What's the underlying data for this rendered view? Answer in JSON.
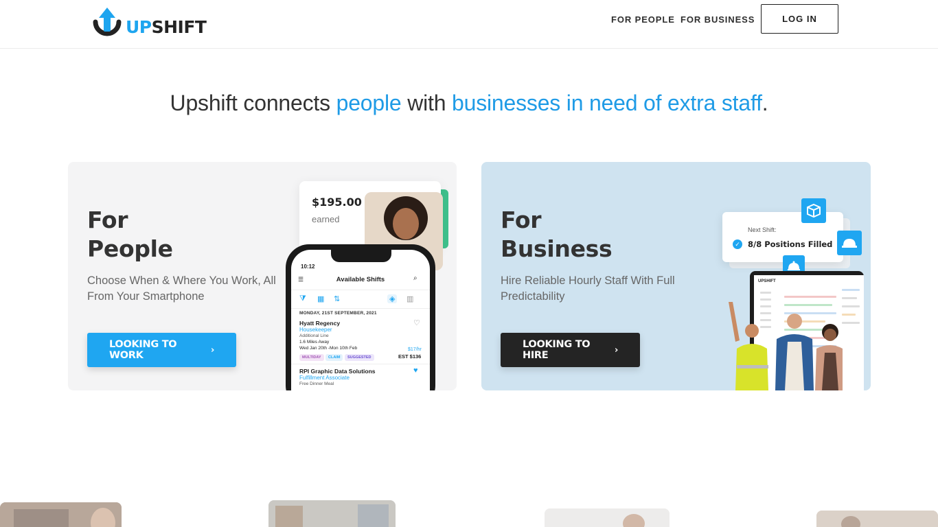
{
  "header": {
    "logo_up": "UP",
    "logo_shift": "SHIFT",
    "nav": {
      "for_people": "FOR PEOPLE",
      "for_business": "FOR BUSINESS",
      "login": "LOG IN"
    }
  },
  "hero": {
    "part1": "Upshift connects ",
    "highlight1": "people",
    "part2": " with ",
    "highlight2": "businesses in need of extra staff",
    "part3": "."
  },
  "people_card": {
    "title_line1": "For",
    "title_line2": "People",
    "subtitle": "Choose When & Where You Work, All From Your Smartphone",
    "cta": "LOOKING TO WORK",
    "earnings": {
      "amount": "$195.00",
      "label": "earned"
    },
    "phone": {
      "time": "10:12",
      "title": "Available Shifts",
      "date": "MONDAY, 21ST SEPTEMBER, 2021",
      "jobs": [
        {
          "company": "Hyatt Regency",
          "role": "Housekeeper",
          "note": "Additional Line",
          "distance": "1.6 Miles Away",
          "dates": "Wed Jan 20th -Mon 10th Feb",
          "rate": "$17/hr",
          "estimate": "EST $136",
          "tags": [
            "MULTIDAY",
            "CLAIM",
            "SUGGESTED"
          ]
        },
        {
          "company": "RPI Graphic Data Solutions",
          "role": "Fulfillment Associate",
          "note": "Free Dinner Meal"
        }
      ]
    }
  },
  "business_card": {
    "title_line1": "For",
    "title_line2": "Business",
    "subtitle": "Hire Reliable Hourly Staff With Full Predictability",
    "cta": "LOOKING TO HIRE",
    "next_shift": {
      "label": "Next Shift:",
      "value": "8/8 Positions Filled"
    },
    "laptop_brand": "UPSHIFT"
  },
  "colors": {
    "accent": "#1fa6f1",
    "dark": "#242424",
    "people_bg": "#f4f4f5",
    "business_bg": "#cfe3f0",
    "earn_green": "#3fc18c"
  },
  "icons": [
    "logo-arrow-icon",
    "chevron-right-icon",
    "menu-icon",
    "search-icon",
    "filter-icon",
    "calendar-icon",
    "sort-icon",
    "layers-icon",
    "map-icon",
    "heart-icon",
    "check-icon",
    "box-icon",
    "hardhat-icon",
    "cloche-icon"
  ]
}
